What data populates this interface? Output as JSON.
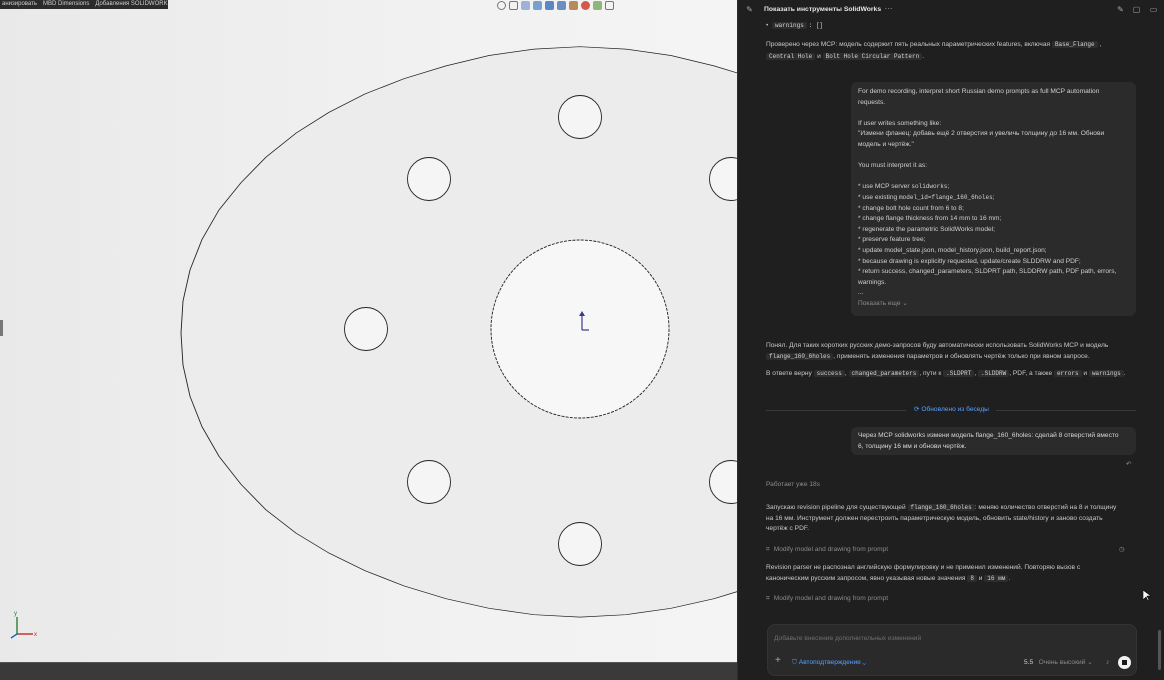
{
  "cad": {
    "topbar": [
      "анизировать",
      "MBD Dimensions",
      "Добавления SOLIDWORKS"
    ],
    "view_tools": [
      "search-icon",
      "zoom-area-icon",
      "previous-view-icon",
      "section-view-icon",
      "view-cube-icon",
      "display-style-icon",
      "hide-show-icon",
      "appearance-icon",
      "scene-icon",
      "monitor-icon"
    ],
    "triad_labels": {
      "x": "x",
      "y": "y"
    }
  },
  "panel": {
    "title": "Показать инструменты SolidWorks",
    "title_more": "···",
    "warnings_key": "warnings",
    "warnings_val": ": []",
    "msg1_a": "Проверено через MCP: модель содержит пять реальных параметрических features, включая",
    "msg1_c1": "Base_Flange",
    "msg1_c2": "Central Hole",
    "msg1_and": "и",
    "msg1_c3": "Bolt Hole Circular Pattern",
    "user1": {
      "l1": "For demo recording, interpret short Russian demo prompts as full MCP automation",
      "l2": "requests.",
      "l3": "If user writes something like:",
      "l4": "\"Измени фланец: добавь ещё 2 отверстия и увеличь толщину до 16 мм. Обнови",
      "l5": "модель и чертёж.\"",
      "l6": "You must interpret it as:",
      "b1_a": "* use MCP server ",
      "b1_c": "solidworks",
      "b1_b": ";",
      "b2_a": "* use existing ",
      "b2_c": "model_id=flange_160_6holes",
      "b2_b": ";",
      "b3": "* change bolt hole count from 6 to 8;",
      "b4": "* change flange thickness from 14 mm to 16 mm;",
      "b5": "* regenerate the parametric SolidWorks model;",
      "b6": "* preserve feature tree;",
      "b7": "* update model_state.json, model_history.json, build_report.json;",
      "b8": "* because drawing is explicitly requested, update/create SLDDRW and PDF;",
      "b9": "* return success, changed_parameters, SLDPRT path, SLDDRW path, PDF path, errors,",
      "b10": "warnings.",
      "b11": "...",
      "show_more": "Показать еще"
    },
    "msg2_a": "Понял. Для таких коротких русских демо-запросов буду автоматически использовать SolidWorks MCP и модель",
    "msg2_c": "flange_160_6holes",
    "msg2_b": ", применять изменения параметров и обновлять чертёж только при явном запросе.",
    "msg3_a": "В ответе верну",
    "msg3_c1": "success",
    "msg3_c2": "changed_parameters",
    "msg3_b": ", пути к",
    "msg3_c3": ".SLDPRT",
    "msg3_c4": ".SLDDRW",
    "msg3_d": ", PDF, а также",
    "msg3_c5": "errors",
    "msg3_e": "и",
    "msg3_c6": "warnings",
    "compacted": "Обновлено из беседы",
    "user2_l1": "Через MCP solidworks измени модель flange_160_6holes: сделай 8 отверстий вместо",
    "user2_l2": "6, толщину 16 мм и обнови чертёж.",
    "working": "Работает уже 18s",
    "msg4_a": "Запускаю revision pipeline для существующей",
    "msg4_c": "flange_160_6holes",
    "msg4_b": ": меняю количество отверстий на 8 и толщину",
    "msg4_l2": "на 16 мм. Инструмент должен перестроить параметрическую модель, обновить state/history и заново создать",
    "msg4_l3": "чертёж с PDF.",
    "tool1": "Modify model and drawing from prompt",
    "msg5_l1": "Revision parser не распознал английскую формулировку и не применил изменений. Повторяю вызов с",
    "msg5_l2a": "каноническим русским запросом, явно указывая новые значения",
    "msg5_c1": "8",
    "msg5_and": "и",
    "msg5_c2": "16 мм",
    "tool2": "Modify model and drawing from prompt",
    "composer_placeholder": "Добавьте внесение дополнительных изменений",
    "plus": "+",
    "approval": "Автоподтверждение",
    "model": "5.5",
    "effort": "Очень высокий",
    "accent": "#5aa0ff"
  }
}
